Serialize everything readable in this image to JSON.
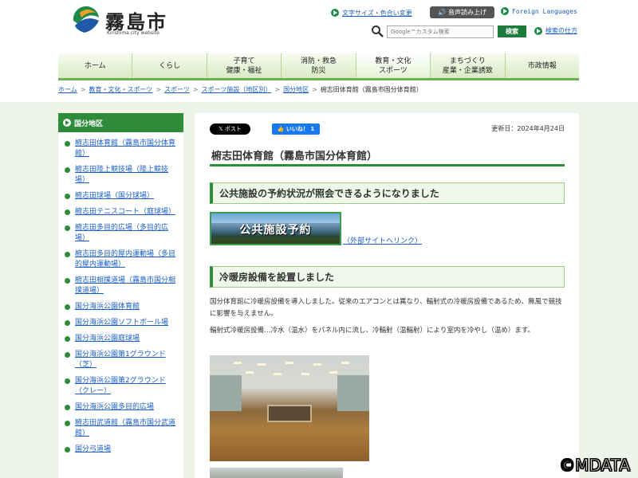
{
  "header": {
    "site_title": "霧島市",
    "site_subtitle": "Kirishima city website",
    "font_color_link": "文字サイズ・色合い変更",
    "voice_button": "音声読み上げ",
    "foreign_link": "Foreign Languages",
    "search_placeholder": "Google™カスタム検索",
    "search_button": "検索",
    "search_howto": "検索の仕方"
  },
  "nav": {
    "items": [
      {
        "label": "ホーム"
      },
      {
        "label": "くらし"
      },
      {
        "label": "子育て\n健康・福祉"
      },
      {
        "label": "消防・救急\n防災"
      },
      {
        "label": "教育・文化\nスポーツ"
      },
      {
        "label": "まちづくり\n産業・企業誘致"
      },
      {
        "label": "市政情報"
      }
    ]
  },
  "breadcrumb": {
    "items": [
      "ホーム",
      "教育・文化・スポーツ",
      "スポーツ",
      "スポーツ施設（地区別）",
      "国分地区"
    ],
    "current": "椨志田体育館（霧島市国分体育館）"
  },
  "sidebar": {
    "heading": "国分地区",
    "items": [
      "椨志田体育館（霧島市国分体育館）",
      "椨志田陸上競技場（陸上競技場）",
      "椨志田球場（国分球場）",
      "椨志田テニスコート（庭球場）",
      "椨志田多目的広場（多目的広場）",
      "椨志田多目的屋内運動場（多目的屋内運動場）",
      "椨志田相撲道場（霧島市国分相撲道場）",
      "国分海浜公園体育館",
      "国分海浜公園ソフトボール場",
      "国分海浜公園庭球場",
      "国分海浜公園第1グラウンド（芝）",
      "国分海浜公園第2グラウンド（クレー）",
      "国分海浜公園多目的広場",
      "椨志田武道館（霧島市国分武道館）",
      "国分弓道場"
    ]
  },
  "main": {
    "x_post": "𝕏 ポスト",
    "fb_like": "👍 いいね！ 1",
    "updated": "更新日：2024年4月24日",
    "title": "椨志田体育館（霧島市国分体育館）",
    "section1": "公共施設の予約状況が照会できるようになりました",
    "banner_text": "公共施設予約",
    "ext_link": "（外部サイトへリンク）",
    "section2": "冷暖房設備を設置しました",
    "para1": "国分体育館に冷暖房設備を導入しました。従来のエアコンとは異なり、輻射式の冷暖房設備であるため、無風で競技に影響を与えません。",
    "para2": "輻射式冷暖房設備…冷水（温水）をパネル内に流し、冷輻射（温輻射）により室内を冷やし（温め）ます。"
  },
  "watermark": "©MDATA",
  "colors": {
    "accent": "#2e8b3a",
    "link": "#1a5ec6"
  }
}
